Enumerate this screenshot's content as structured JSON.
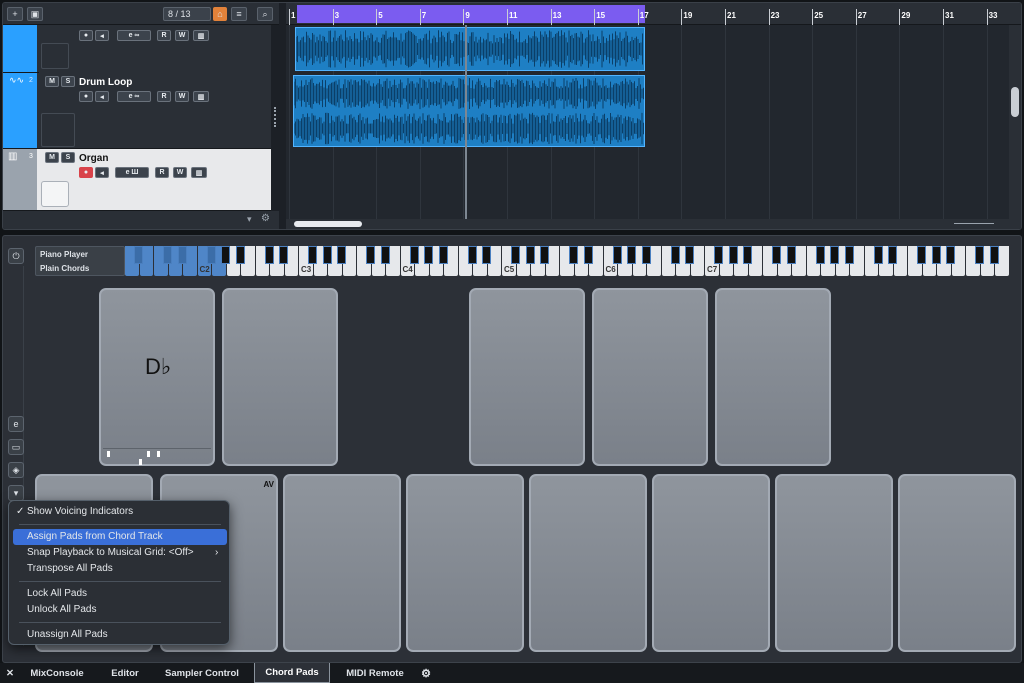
{
  "toolbar": {
    "add_icon": "plus-icon",
    "folder_icon": "folder-add-icon",
    "track_count": "8 / 13",
    "search_icon": "search-icon"
  },
  "tracks": [
    {
      "number": "",
      "name": "",
      "color": "#2aa0ff"
    },
    {
      "number": "2",
      "name": "Drum Loop",
      "mute": "M",
      "solo": "S",
      "color": "#2aa0ff"
    },
    {
      "number": "3",
      "name": "Organ",
      "mute": "M",
      "solo": "S",
      "color": "#9aa3ad"
    }
  ],
  "track_buttons": {
    "read": "R",
    "write": "W"
  },
  "ruler": {
    "bars": [
      "1",
      "3",
      "5",
      "7",
      "9",
      "11",
      "13",
      "15",
      "17",
      "19",
      "21",
      "23",
      "25",
      "27",
      "29",
      "31",
      "33"
    ]
  },
  "chord_pads": {
    "player": "Piano Player",
    "voicing": "Plain Chords",
    "octave_labels": [
      "C2",
      "C3",
      "C4",
      "C5",
      "C6",
      "C7"
    ],
    "pad1_chord": "D♭",
    "pad_av": "AV"
  },
  "menu": {
    "show_voicing": "Show Voicing Indicators",
    "assign": "Assign Pads from Chord Track",
    "snap": "Snap Playback to Musical Grid: <Off>",
    "transpose": "Transpose All Pads",
    "lock": "Lock All Pads",
    "unlock": "Unlock All Pads",
    "unassign": "Unassign All Pads"
  },
  "tabs": {
    "close": "✕",
    "mixconsole": "MixConsole",
    "editor": "Editor",
    "sampler": "Sampler Control",
    "chordpads": "Chord Pads",
    "midiremote": "MIDI Remote",
    "settings_icon": "gear-icon"
  },
  "colors": {
    "cycle": "#7b5cf0",
    "clip": "#1e7fc4",
    "menu_highlight": "#3a6fd8",
    "record": "#d9434a"
  }
}
